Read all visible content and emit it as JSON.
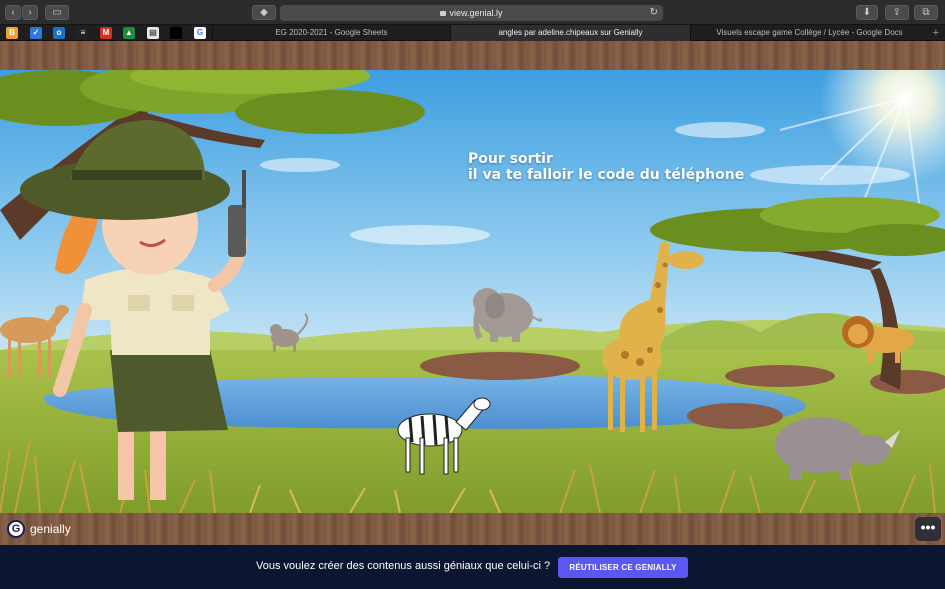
{
  "browser": {
    "url": "view.genial.ly",
    "tabs": [
      {
        "label": "EG 2020-2021 - Google Sheets",
        "active": false
      },
      {
        "label": "angles par adeline.chipeaux sur Genially",
        "active": true
      },
      {
        "label": "Visuels escape game Collège / Lycée - Google Docs",
        "active": false
      }
    ],
    "toolbar_icons": [
      "back-arrow-icon",
      "forward-arrow-icon",
      "sidebar-icon",
      "tag-icon",
      "lock-icon",
      "reload-icon",
      "download-icon",
      "share-icon",
      "tabs-overview-icon"
    ],
    "bookmark_icons": [
      "bookmark-orange-icon",
      "bookmark-blue-icon",
      "bookmark-outlook-icon",
      "bookmark-flag-icon",
      "bookmark-gmail-icon",
      "bookmark-drive-icon",
      "bookmark-notes-icon",
      "bookmark-dark-icon",
      "bookmark-google-icon"
    ]
  },
  "scene": {
    "title_line1": "Pour sortir",
    "title_line2": "il va te falloir le code du téléphone",
    "elements": [
      "ranger-girl",
      "walkie-talkie",
      "acacia-tree",
      "giraffe",
      "elephant",
      "zebra",
      "rhino",
      "lion",
      "gazelle",
      "monkey",
      "waterhole",
      "savanna-grass",
      "sun"
    ]
  },
  "genially": {
    "logo_text": "genially",
    "more_label": "•••"
  },
  "banner": {
    "text": "Vous voulez créer des contenus aussi géniaux que celui-ci ?",
    "button_label": "RÉUTILISER CE GENIALLY"
  },
  "colors": {
    "sky_top": "#3d9ee0",
    "grass": "#8fb233",
    "water": "#5b9bd8",
    "wood": "#7d5840",
    "banner_bg": "#0c1531",
    "button_accent": "#5b57f2"
  }
}
